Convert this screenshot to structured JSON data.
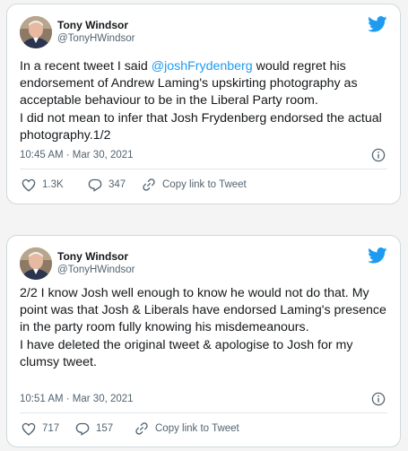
{
  "tweets": [
    {
      "author": {
        "name": "Tony Windsor",
        "handle": "@TonyHWindsor"
      },
      "text_parts": [
        "In a recent tweet I said ",
        "@joshFrydenberg",
        " would regret his endorsement of Andrew Laming's upskirting photography as acceptable behaviour to be in the Liberal Party room.",
        "I did not mean to infer that Josh Frydenberg endorsed the actual photography.1/2"
      ],
      "timestamp": "10:45 AM · Mar 30, 2021",
      "likes": "1.3K",
      "replies": "347",
      "copy_link_label": "Copy link to Tweet"
    },
    {
      "author": {
        "name": "Tony Windsor",
        "handle": "@TonyHWindsor"
      },
      "text_parts": [
        "2/2 I know Josh well enough to know he would not do that. My point was that Josh & Liberals have endorsed Laming's presence in the party room fully knowing his misdemeanours.",
        "I have deleted the original tweet & apologise to Josh for my clumsy tweet."
      ],
      "timestamp": "10:51 AM · Mar 30, 2021",
      "likes": "717",
      "replies": "157",
      "copy_link_label": "Copy link to Tweet"
    }
  ],
  "colors": {
    "twitter_blue": "#1d9bf0",
    "text": "#14171a",
    "muted": "#536471",
    "border": "#cfd9de"
  },
  "icons": [
    "twitter-bird-icon",
    "info-icon",
    "heart-icon",
    "reply-icon",
    "link-icon"
  ]
}
